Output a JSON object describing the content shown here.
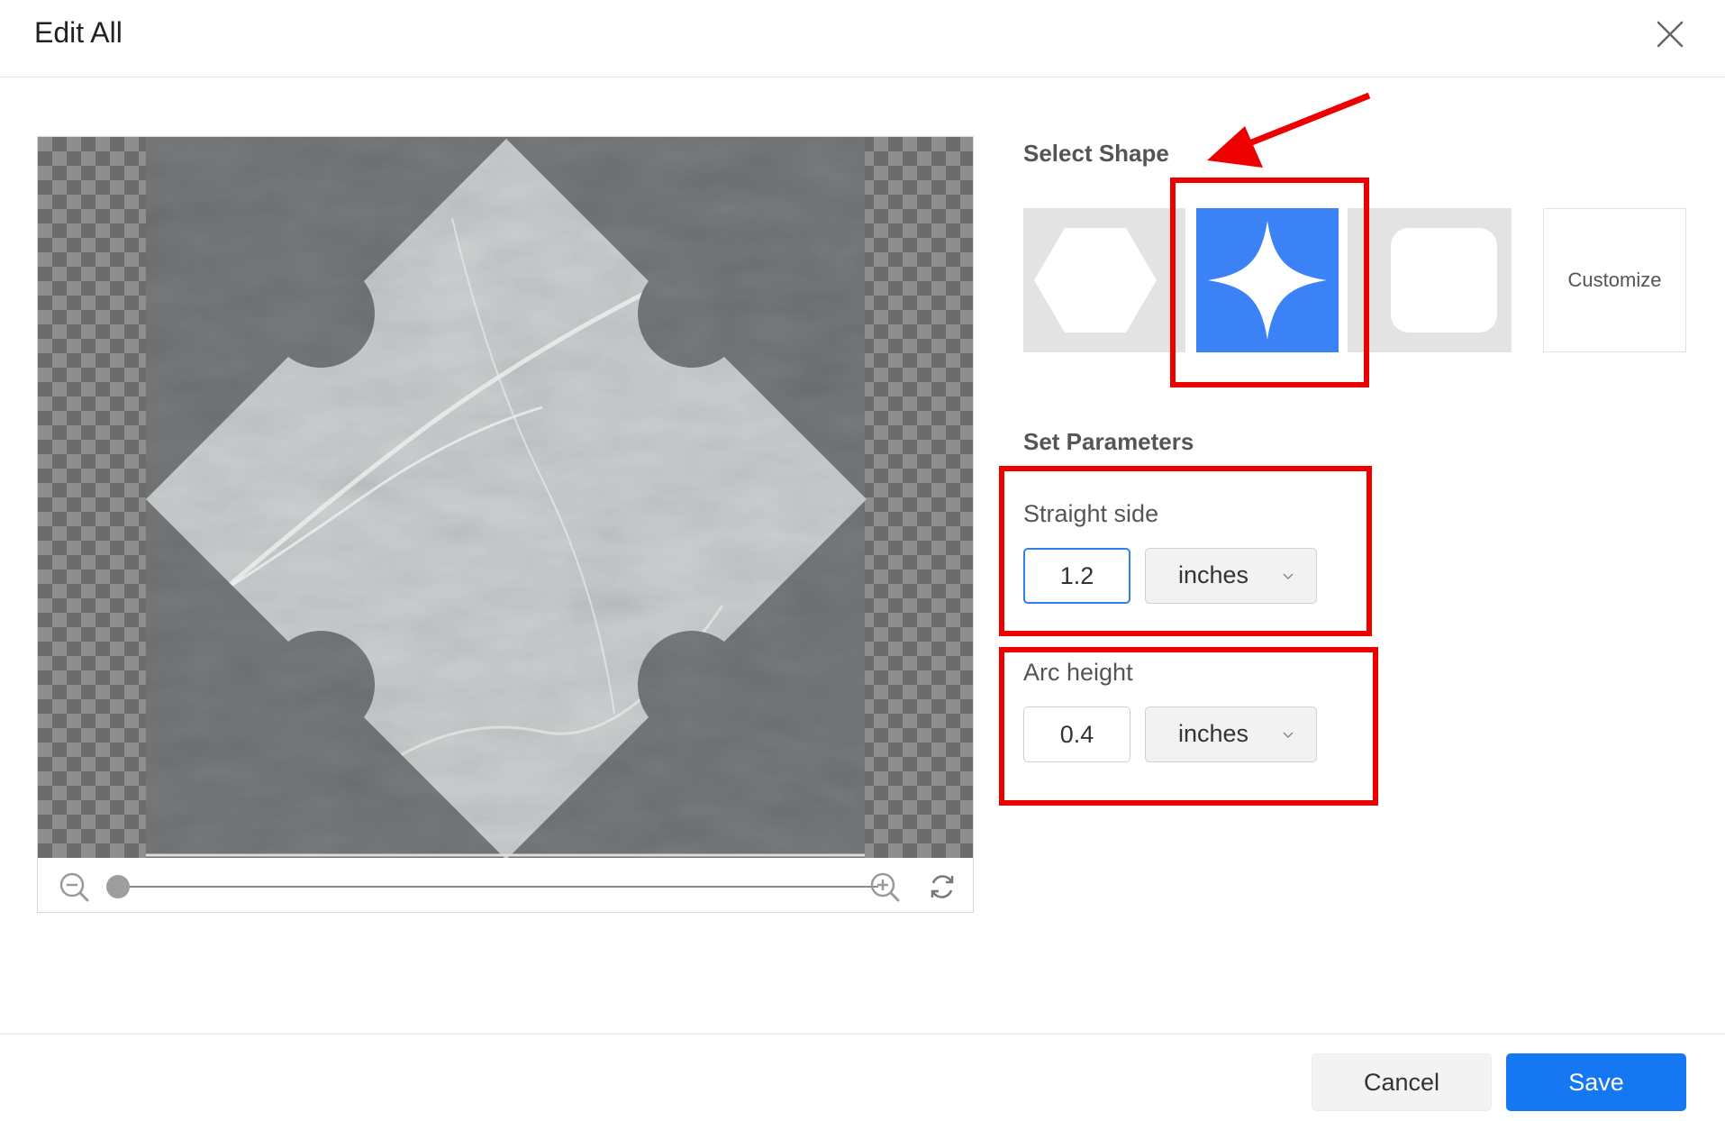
{
  "dialog": {
    "title": "Edit All",
    "close_icon": "close-icon"
  },
  "preview": {
    "zoom_level": 0,
    "zoom_out_icon": "zoom-out-icon",
    "zoom_in_icon": "zoom-in-icon",
    "reset_icon": "rotate-reset-icon"
  },
  "select_shape": {
    "title": "Select Shape",
    "options": [
      {
        "icon": "hexagon-shape-icon",
        "selected": false
      },
      {
        "icon": "four-point-star-shape-icon",
        "selected": true
      },
      {
        "icon": "rounded-square-shape-icon",
        "selected": false
      }
    ],
    "customize_label": "Customize"
  },
  "parameters": {
    "title": "Set Parameters",
    "straight_side": {
      "label": "Straight side",
      "value": "1.2",
      "unit": "inches"
    },
    "arc_height": {
      "label": "Arc height",
      "value": "0.4",
      "unit": "inches"
    }
  },
  "footer": {
    "cancel_label": "Cancel",
    "save_label": "Save"
  },
  "colors": {
    "accent": "#1677f3",
    "selected_shape": "#3b82f6",
    "highlight": "#ee0000"
  }
}
